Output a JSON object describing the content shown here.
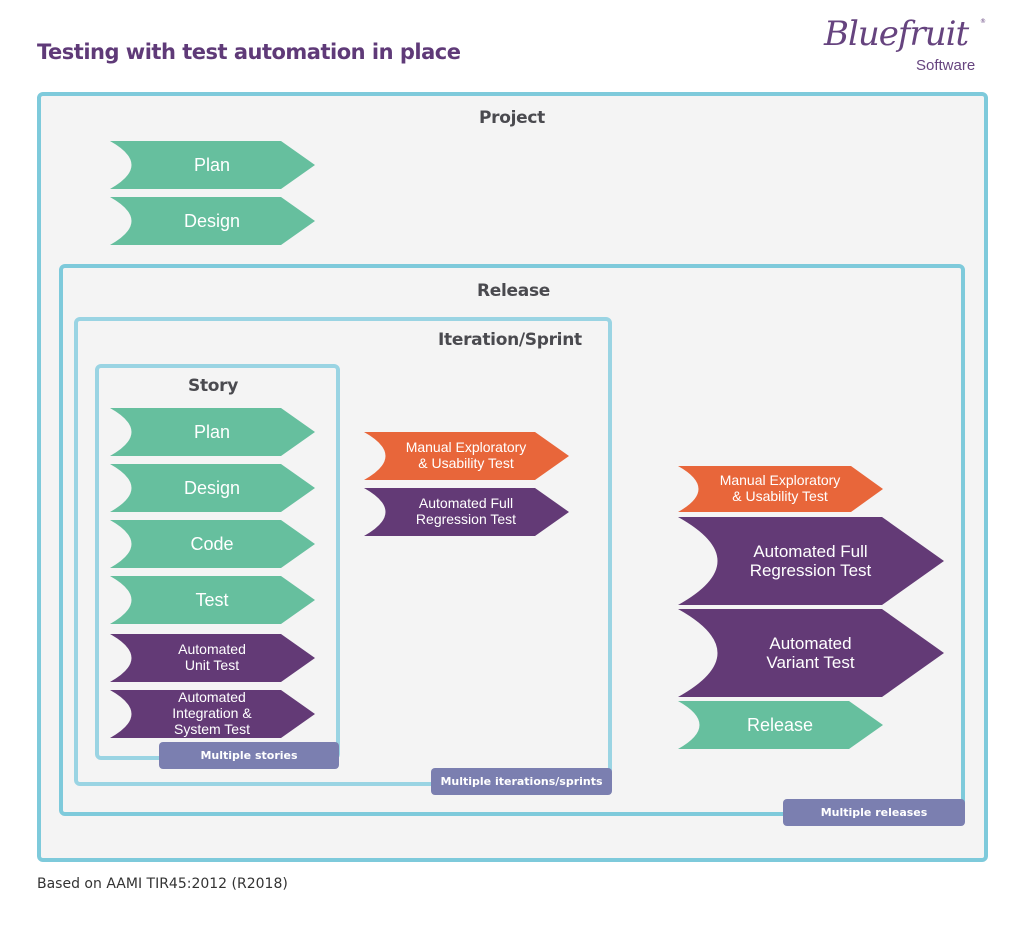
{
  "title": "Testing with test automation in place",
  "logo": {
    "name": "Bluefruit",
    "subtitle": "Software",
    "registered": "®"
  },
  "colors": {
    "title": "#5f3a78",
    "border": "#7ecadb",
    "green": "#66bf9e",
    "purple": "#633a76",
    "orange": "#e8663a",
    "tag": "#7b7fb0",
    "label": "#4a4a4f"
  },
  "project": {
    "label": "Project",
    "steps": [
      {
        "label": "Plan",
        "type": "green"
      },
      {
        "label": "Design",
        "type": "green"
      }
    ]
  },
  "release": {
    "label": "Release",
    "tag": "Multiple releases",
    "steps": [
      {
        "label": "Manual Exploratory\n& Usability Test",
        "type": "orange"
      },
      {
        "label": "Automated Full\nRegression Test",
        "type": "purple"
      },
      {
        "label": "Automated\nVariant Test",
        "type": "purple"
      },
      {
        "label": "Release",
        "type": "green"
      }
    ]
  },
  "iteration": {
    "label": "Iteration/Sprint",
    "tag": "Multiple iterations/sprints",
    "steps": [
      {
        "label": "Manual Exploratory\n& Usability Test",
        "type": "orange"
      },
      {
        "label": "Automated Full\nRegression Test",
        "type": "purple"
      }
    ]
  },
  "story": {
    "label": "Story",
    "tag": "Multiple stories",
    "steps": [
      {
        "label": "Plan",
        "type": "green"
      },
      {
        "label": "Design",
        "type": "green"
      },
      {
        "label": "Code",
        "type": "green"
      },
      {
        "label": "Test",
        "type": "green"
      },
      {
        "label": "Automated\nUnit Test",
        "type": "purple"
      },
      {
        "label": "Automated\nIntegration &\nSystem Test",
        "type": "purple"
      }
    ]
  },
  "footer": "Based on AAMI TIR45:2012 (R2018)"
}
